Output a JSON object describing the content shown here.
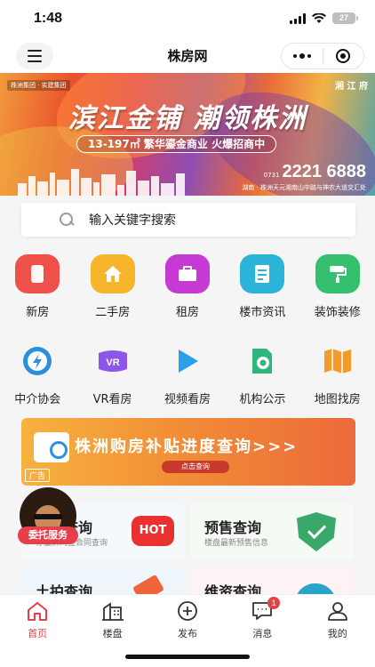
{
  "status": {
    "time": "1:48",
    "battery": "27"
  },
  "nav": {
    "title": "株房网"
  },
  "banner": {
    "logo_left": "株洲集团 · 实建集团",
    "logo_right": "湘 江 府",
    "headline": "滨江金铺 潮领株洲",
    "sub": "13-197㎡ 繁华鎏金商业  火爆招商中",
    "phone_prefix": "0731",
    "phone": "2221 6888",
    "address": "湖南 · 株洲天元湘南山中路与神农大道交汇处"
  },
  "search": {
    "placeholder": "输入关键字搜索"
  },
  "grid_row1": [
    {
      "label": "新房",
      "color": "#f0504a",
      "icon": "building-icon"
    },
    {
      "label": "二手房",
      "color": "#f7b52c",
      "icon": "house-icon"
    },
    {
      "label": "租房",
      "color": "#c63ad3",
      "icon": "briefcase-icon"
    },
    {
      "label": "楼市资讯",
      "color": "#2bb4d8",
      "icon": "news-icon"
    },
    {
      "label": "装饰装修",
      "color": "#34c06f",
      "icon": "paint-roller-icon"
    }
  ],
  "grid_row2": [
    {
      "label": "中介协会",
      "color": "#2b8fe0",
      "icon": "agency-icon"
    },
    {
      "label": "VR看房",
      "color": "#8e56e8",
      "icon": "vr-icon"
    },
    {
      "label": "视频看房",
      "color": "#2aa0e8",
      "icon": "play-icon"
    },
    {
      "label": "机构公示",
      "color": "#2eb67c",
      "icon": "institution-icon"
    },
    {
      "label": "地图找房",
      "color": "#f39b2a",
      "icon": "map-icon"
    }
  ],
  "ad": {
    "title": "株洲购房补贴进度查询>>>",
    "button": "点击查询",
    "tag": "广告"
  },
  "cards": [
    {
      "title": "网签查询",
      "desc": "存量房网签合同查询"
    },
    {
      "title": "预售查询",
      "desc": "楼盘最新预售信息"
    },
    {
      "title": "土拍查询",
      "desc": ""
    },
    {
      "title": "维资查询",
      "desc": ""
    }
  ],
  "hot_label": "HOT",
  "float": {
    "label": "委托服务"
  },
  "tabs": [
    {
      "label": "首页",
      "icon": "home-icon"
    },
    {
      "label": "楼盘",
      "icon": "buildings-icon"
    },
    {
      "label": "发布",
      "icon": "plus-circle-icon"
    },
    {
      "label": "消息",
      "icon": "message-icon",
      "badge": "1"
    },
    {
      "label": "我的",
      "icon": "user-icon"
    }
  ],
  "colors": {
    "accent": "#e73f4a"
  }
}
